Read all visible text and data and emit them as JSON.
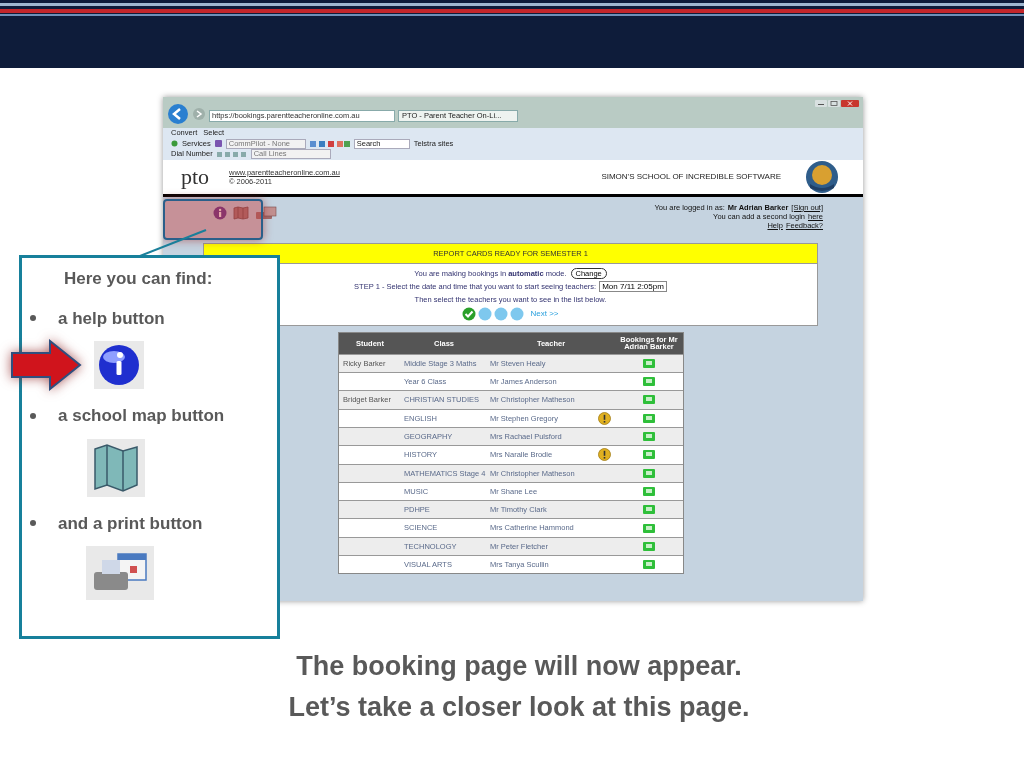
{
  "browser": {
    "address": "https://bookings.parentteacheronline.com.au",
    "tab": "PTO - Parent Teacher On-Li...",
    "toolbar_1": [
      "Convert",
      "Select"
    ],
    "services": "Services",
    "commpilot": "CommPilot - None",
    "search": "Search",
    "sites": "Telstra sites",
    "dial": "Dial Number",
    "lines": "Call Lines"
  },
  "site_header": {
    "logo": "pto",
    "url": "www.parentteacheronline.com.au",
    "copyright": "© 2006-2011",
    "school": "SIMON'S SCHOOL OF INCREDIBLE SOFTWARE"
  },
  "login": {
    "prefix": "You are logged in as:",
    "user": "Mr Adrian Barker",
    "sign_out": "[Sign out]",
    "second": "You can add a second login",
    "here": "here",
    "help": "Help",
    "feedback": "Feedback?"
  },
  "banner": "REPORT CARDS READY FOR SEMESTER 1",
  "mode_text": "You are making bookings in **automatic** mode.",
  "change_button": "Change",
  "step_text": "STEP 1 - Select the date and time that you want to start seeing teachers:",
  "date_select": "Mon 7/11 2:05pm",
  "then_text": "Then select the teachers you want to see in the list below.",
  "steps": [
    {
      "done": true
    },
    {
      "done": false
    },
    {
      "done": false
    },
    {
      "done": false
    }
  ],
  "next": "Next >>",
  "table": {
    "columns": [
      "Student",
      "Class",
      "Teacher",
      "Bookings for Mr Adrian Barker"
    ],
    "rows": [
      {
        "student": "Ricky Barker",
        "class": "Middle Stage 3 Maths",
        "teacher": "Mr Steven Healy",
        "warning": false
      },
      {
        "class": "Year 6 Class",
        "teacher": "Mr James Anderson",
        "warning": false
      },
      {
        "student": "Bridget Barker",
        "class": "CHRISTIAN STUDIES",
        "teacher": "Mr Christopher Matheson",
        "warning": false
      },
      {
        "class": "ENGLISH",
        "teacher": "Mr Stephen Gregory",
        "warning": true
      },
      {
        "class": "GEOGRAPHY",
        "teacher": "Mrs Rachael Pulsford",
        "warning": false
      },
      {
        "class": "HISTORY",
        "teacher": "Mrs Naralle Brodie",
        "warning": true
      },
      {
        "class": "MATHEMATICS Stage 4",
        "teacher": "Mr Christopher Matheson",
        "warning": false
      },
      {
        "class": "MUSIC",
        "teacher": "Mr Shane Lee",
        "warning": false
      },
      {
        "class": "PDHPE",
        "teacher": "Mr Timothy Clark",
        "warning": false
      },
      {
        "class": "SCIENCE",
        "teacher": "Mrs Catherine Hammond",
        "warning": false
      },
      {
        "class": "TECHNOLOGY",
        "teacher": "Mr Peter Fletcher",
        "warning": false
      },
      {
        "class": "VISUAL ARTS",
        "teacher": "Mrs Tanya Scullin",
        "warning": false
      }
    ]
  },
  "callout": {
    "heading": "Here you can find:",
    "items": [
      {
        "label": "a help button",
        "kind": "info",
        "pointed": true
      },
      {
        "label": "a school map button",
        "kind": "map",
        "pointed": false
      },
      {
        "label": "and a print button",
        "kind": "print",
        "pointed": false
      }
    ]
  },
  "caption": [
    "The booking page will now appear.",
    "Let’s take a closer look at this page."
  ]
}
